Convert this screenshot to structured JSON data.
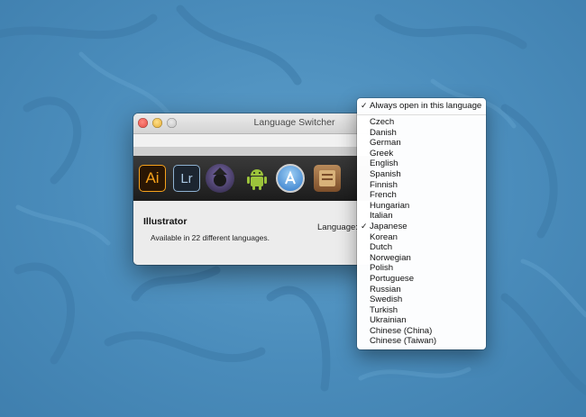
{
  "window": {
    "title": "Language Switcher",
    "app_name": "Illustrator",
    "app_description": "Available in 22 different languages.",
    "language_label": "Language:"
  },
  "app_icons": [
    {
      "name": "illustrator-icon",
      "text": "Ai"
    },
    {
      "name": "lightroom-icon",
      "text": "Lr"
    },
    {
      "name": "alfred-icon"
    },
    {
      "name": "android-icon"
    },
    {
      "name": "app-store-icon"
    },
    {
      "name": "books-icon"
    }
  ],
  "menu": {
    "always_open": {
      "label": "Always open in this language",
      "checked": true
    },
    "languages": [
      {
        "label": "Czech"
      },
      {
        "label": "Danish"
      },
      {
        "label": "German"
      },
      {
        "label": "Greek"
      },
      {
        "label": "English"
      },
      {
        "label": "Spanish"
      },
      {
        "label": "Finnish"
      },
      {
        "label": "French"
      },
      {
        "label": "Hungarian"
      },
      {
        "label": "Italian"
      },
      {
        "label": "Japanese",
        "checked": true
      },
      {
        "label": "Korean"
      },
      {
        "label": "Dutch"
      },
      {
        "label": "Norwegian"
      },
      {
        "label": "Polish"
      },
      {
        "label": "Portuguese"
      },
      {
        "label": "Russian"
      },
      {
        "label": "Swedish"
      },
      {
        "label": "Turkish"
      },
      {
        "label": "Ukrainian"
      },
      {
        "label": "Chinese (China)"
      },
      {
        "label": "Chinese (Taiwan)"
      }
    ]
  },
  "check_glyph": "✓"
}
